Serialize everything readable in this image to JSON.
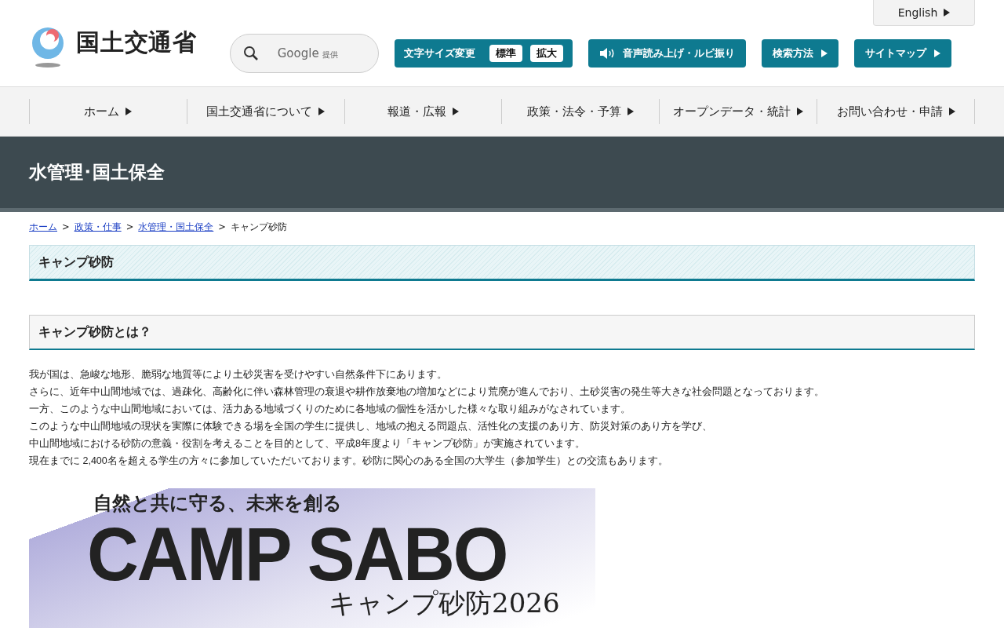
{
  "header": {
    "logo_text": "国土交通省",
    "search": {
      "provider": "Google",
      "provider_note": "提供"
    },
    "language_link": "English",
    "font_size": {
      "label": "文字サイズ変更",
      "options": [
        {
          "label": "標準"
        },
        {
          "label": "拡大"
        }
      ]
    },
    "buttons": [
      {
        "label": "音声読み上げ・ルビ振り",
        "kind": "speaker"
      },
      {
        "label": "検索方法",
        "kind": "arrow"
      },
      {
        "label": "サイトマップ",
        "kind": "arrow"
      }
    ]
  },
  "nav": [
    {
      "label": "ホーム"
    },
    {
      "label": "国土交通省について"
    },
    {
      "label": "報道・広報"
    },
    {
      "label": "政策・法令・予算"
    },
    {
      "label": "オープンデータ・統計"
    },
    {
      "label": "お問い合わせ・申請"
    }
  ],
  "section_title": "水管理･国土保全",
  "breadcrumb_separator": ">",
  "breadcrumb": [
    {
      "label": "ホーム",
      "kind": "link"
    },
    {
      "label": "政策・仕事",
      "kind": "link"
    },
    {
      "label": "水管理・国土保全",
      "kind": "link"
    },
    {
      "label": "キャンプ砂防",
      "kind": "current"
    }
  ],
  "page_heading": "キャンプ砂防",
  "subheading": "キャンプ砂防とは？",
  "paragraphs": [
    "我が国は、急峻な地形、脆弱な地質等により土砂災害を受けやすい自然条件下にあります。",
    "さらに、近年中山間地域では、過疎化、高齢化に伴い森林管理の衰退や耕作放棄地の増加などにより荒廃が進んでおり、土砂災害の発生等大きな社会問題となっております。",
    "一方、このような中山間地域においては、活力ある地域づくりのために各地域の個性を活かした様々な取り組みがなされています。",
    "このような中山間地域の現状を実際に体験できる場を全国の学生に提供し、地域の抱える問題点、活性化の支援のあり方、防災対策のあり方を学び、",
    "中山間地域における砂防の意義・役割を考えることを目的として、平成8年度より「キャンプ砂防」が実施されています。",
    "現在までに 2,400名を超える学生の方々に参加していただいております。砂防に関心のある全国の大学生（参加学生）との交流もあります。"
  ],
  "banner": {
    "tagline": "自然と共に守る、未来を創る",
    "title": "CAMP SABO",
    "subtitle": "キャンプ砂防2026"
  }
}
